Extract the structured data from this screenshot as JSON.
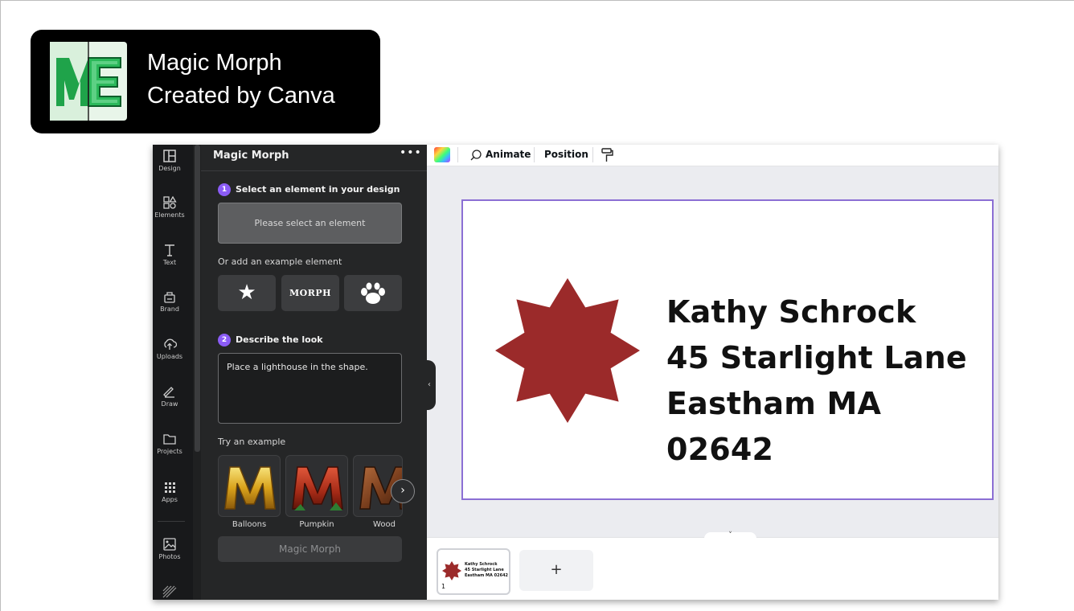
{
  "badge": {
    "line1": "Magic Morph",
    "line2": "Created by Canva"
  },
  "rail": {
    "items": [
      {
        "label": "Design",
        "icon": "layout-icon"
      },
      {
        "label": "Elements",
        "icon": "shapes-icon"
      },
      {
        "label": "Text",
        "icon": "text-icon"
      },
      {
        "label": "Brand",
        "icon": "brand-icon"
      },
      {
        "label": "Uploads",
        "icon": "cloud-upload-icon"
      },
      {
        "label": "Draw",
        "icon": "pen-icon"
      },
      {
        "label": "Projects",
        "icon": "folder-icon"
      },
      {
        "label": "Apps",
        "icon": "grid-icon"
      },
      {
        "label": "Photos",
        "icon": "image-icon"
      }
    ]
  },
  "panel": {
    "title": "Magic Morph",
    "more": "•••",
    "step1_num": "1",
    "step1_label": "Select an element in your design",
    "select_placeholder": "Please select an element",
    "or_add": "Or add an example element",
    "example_star": "★",
    "example_morph": "MORPH",
    "step2_num": "2",
    "step2_label": "Describe the look",
    "description": "Place a lighthouse in the shape.",
    "try_example": "Try an example",
    "examples": [
      {
        "label": "Balloons"
      },
      {
        "label": "Pumpkin"
      },
      {
        "label": "Wood"
      }
    ],
    "next": "›",
    "action_button": "Magic Morph"
  },
  "toolbar": {
    "animate": "Animate",
    "position": "Position"
  },
  "design": {
    "line1": "Kathy Schrock",
    "line2": "45 Starlight Lane",
    "line3": "Eastham MA 02642",
    "shape_color": "#9b2a2a"
  },
  "pages": {
    "thumb_line1": "Kathy Schrock",
    "thumb_line2": "45 Starlight Lane",
    "thumb_line3": "Eastham MA 02642",
    "page_number": "1",
    "add": "+",
    "collapse": "˅"
  },
  "colors": {
    "accent": "#8b5cf6",
    "selection_border": "#8b6fd4",
    "panel_bg": "#252627"
  }
}
